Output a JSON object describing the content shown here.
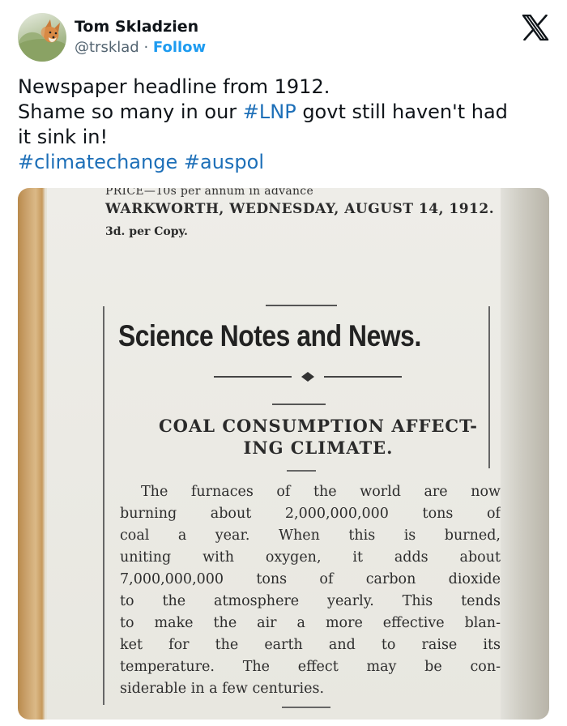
{
  "user": {
    "name": "Tom Skladzien",
    "handle": "@trsklad",
    "separator": " · ",
    "follow_label": "Follow"
  },
  "icons": {
    "platform": "x-logo-icon"
  },
  "tweet": {
    "line1": "Newspaper headline from 1912.",
    "line2_pre": "Shame so many in our ",
    "line2_tag": "#LNP",
    "line2_post": " govt still haven't had",
    "line3": "it sink in!",
    "tag1": "#climatechange",
    "tag2": "#auspol",
    "hashtag_color": "#1d6fb8"
  },
  "newspaper": {
    "price_line": "PRICE—10s per annum in advance",
    "dateline": "WARKWORTH, WEDNESDAY, AUGUST 14, 1912.",
    "copy_price": "3d. per Copy.",
    "section_title": "Science Notes and News.",
    "article_title": [
      "COAL CONSUMPTION AFFECT-",
      "ING CLIMATE."
    ],
    "body_lines": [
      "The furnaces of the world are now",
      "burning about 2,000,000,000 tons of",
      "coal a year. When this is burned,",
      "uniting with oxygen, it adds about",
      "7,000,000,000 tons of carbon dioxide",
      "to the atmosphere yearly. This tends",
      "to make the air a more effective blan-",
      "ket for the earth and to raise its",
      "temperature. The effect may be con-",
      "siderable in a few centuries."
    ]
  }
}
